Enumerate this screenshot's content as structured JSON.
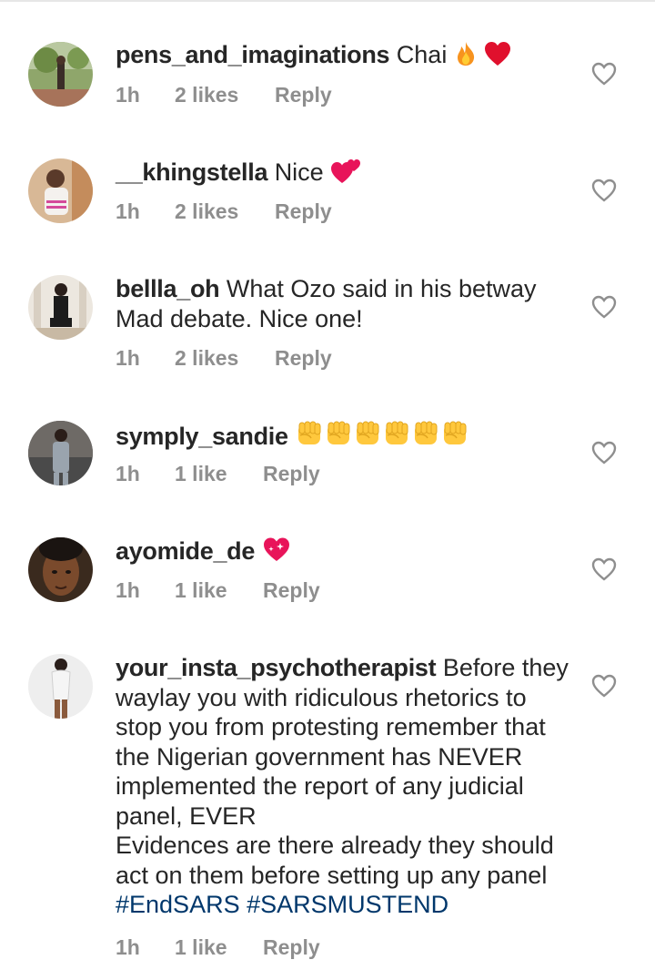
{
  "comments": [
    {
      "username": "pens_and_imaginations",
      "text": "Chai",
      "emoji": [
        "fire-emoji",
        "red-heart-emoji"
      ],
      "time": "1h",
      "likes": "2 likes",
      "reply": "Reply"
    },
    {
      "username": "__khingstella",
      "text": "Nice",
      "emoji": [
        "two-hearts-emoji"
      ],
      "time": "1h",
      "likes": "2 likes",
      "reply": "Reply"
    },
    {
      "username": "bellla_oh",
      "text": "What Ozo said in his betway Mad debate. Nice one!",
      "time": "1h",
      "likes": "2 likes",
      "reply": "Reply"
    },
    {
      "username": "symply_sandie",
      "text": "",
      "emoji": [
        "raised-fist-emoji",
        "raised-fist-emoji",
        "raised-fist-emoji",
        "raised-fist-emoji",
        "raised-fist-emoji",
        "raised-fist-emoji"
      ],
      "time": "1h",
      "likes": "1 like",
      "reply": "Reply"
    },
    {
      "username": "ayomide_de",
      "text": "",
      "emoji": [
        "sparkling-heart-emoji"
      ],
      "time": "1h",
      "likes": "1 like",
      "reply": "Reply"
    },
    {
      "username": "your_insta_psychotherapist",
      "text": "Before they waylay you with ridiculous rhetorics to stop you from protesting remember that the Nigerian government has NEVER implemented the report of any judicial panel, EVER",
      "text2": "Evidences are there already they should act on them before setting up any panel",
      "hashtags": [
        "#EndSARS",
        "#SARSMUSTEND"
      ],
      "time": "1h",
      "likes": "1 like",
      "reply": "Reply"
    }
  ],
  "colors": {
    "text": "#262626",
    "meta": "#8e8e8e",
    "hashtag": "#00376b"
  }
}
